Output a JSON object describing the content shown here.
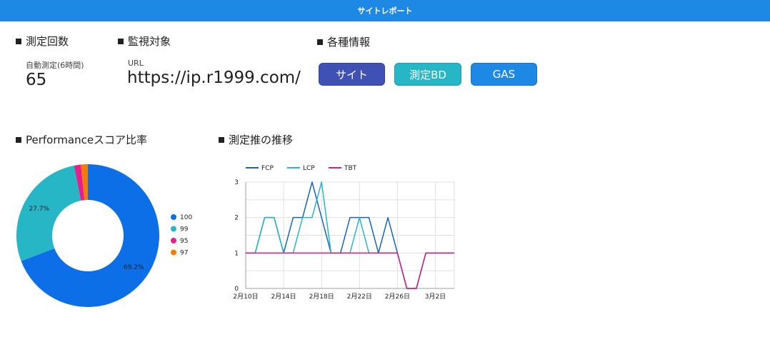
{
  "header": {
    "title": "サイトレポート"
  },
  "measure": {
    "title": "測定回数",
    "label": "自動測定(6時間)",
    "value": "65"
  },
  "target": {
    "title": "監視対象",
    "label": "URL",
    "url": "https://ip.r1999.com/"
  },
  "info": {
    "title": "各種情報",
    "buttons": [
      {
        "label": "サイト",
        "color": "#3f51b5"
      },
      {
        "label": "測定BD",
        "color": "#26b6c6"
      },
      {
        "label": "GAS",
        "color": "#1e88e5"
      }
    ]
  },
  "perf": {
    "title": "Performanceスコア比率"
  },
  "trend": {
    "title": "測定推の推移"
  },
  "chart_data": [
    {
      "type": "pie",
      "labels": [
        "100",
        "99",
        "95",
        "97"
      ],
      "values": [
        69.2,
        27.7,
        1.55,
        1.55
      ],
      "data_labels": [
        "69.2%",
        "27.7%",
        "",
        ""
      ],
      "colors": [
        "#0d6fe8",
        "#26b6c6",
        "#e91e8c",
        "#f57c00"
      ],
      "donut": true,
      "legend": "right"
    },
    {
      "type": "line",
      "x": [
        "2月10日",
        "2月11日",
        "2月12日",
        "2月13日",
        "2月14日",
        "2月15日",
        "2月16日",
        "2月17日",
        "2月18日",
        "2月19日",
        "2月20日",
        "2月21日",
        "2月22日",
        "2月23日",
        "2月24日",
        "2月25日",
        "2月26日",
        "2月27日",
        "2月28日",
        "3月1日",
        "3月2日",
        "3月3日",
        "3月4日"
      ],
      "xticks": [
        "2月10日",
        "2月14日",
        "2月18日",
        "2月22日",
        "2月26日",
        "3月2日"
      ],
      "series": [
        {
          "name": "FCP",
          "color": "#1565c0",
          "values": [
            1,
            1,
            2,
            2,
            1,
            2,
            2,
            3,
            2,
            1,
            1,
            2,
            2,
            2,
            1,
            2,
            1,
            0,
            0,
            1,
            1,
            1,
            1
          ]
        },
        {
          "name": "LCP",
          "color": "#26b6c6",
          "values": [
            1,
            1,
            2,
            2,
            1,
            1,
            2,
            2,
            3,
            1,
            1,
            1,
            2,
            1,
            1,
            1,
            1,
            0,
            0,
            1,
            1,
            1,
            1
          ]
        },
        {
          "name": "TBT",
          "color": "#d81b8c",
          "values": [
            1,
            1,
            1,
            1,
            1,
            1,
            1,
            1,
            1,
            1,
            1,
            1,
            1,
            1,
            1,
            1,
            1,
            0,
            0,
            1,
            1,
            1,
            1
          ]
        }
      ],
      "ylim": [
        0,
        3
      ],
      "yticks": [
        0,
        1,
        2,
        3
      ],
      "grid": true,
      "legend": "top-left"
    }
  ]
}
